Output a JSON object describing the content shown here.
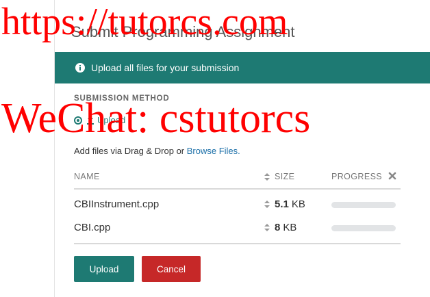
{
  "modal": {
    "title": "Submit Programming Assignment"
  },
  "alert": {
    "icon": "info-icon",
    "text": "Upload all files for your submission"
  },
  "submission_method": {
    "heading": "SUBMISSION METHOD",
    "option_label": "Upload",
    "option_icon": "upload-icon"
  },
  "dropzone": {
    "text": "Add files via Drag & Drop or ",
    "browse_link": "Browse Files."
  },
  "table": {
    "columns": {
      "name": "NAME",
      "size": "SIZE",
      "progress": "PROGRESS",
      "remove_icon": "close-icon"
    },
    "rows": [
      {
        "name": "CBIInstrument.cpp",
        "size_value": "5.1",
        "size_unit": "KB",
        "progress": 0
      },
      {
        "name": "CBI.cpp",
        "size_value": "8",
        "size_unit": "KB",
        "progress": 0
      }
    ]
  },
  "buttons": {
    "upload": "Upload",
    "cancel": "Cancel"
  },
  "watermark": {
    "line1": "https://tutorcs.com",
    "line2": "WeChat: cstutorcs"
  },
  "colors": {
    "accent": "#1e7a73",
    "danger": "#c62828",
    "link": "#1b6fa8",
    "watermark": "#ff0000"
  }
}
